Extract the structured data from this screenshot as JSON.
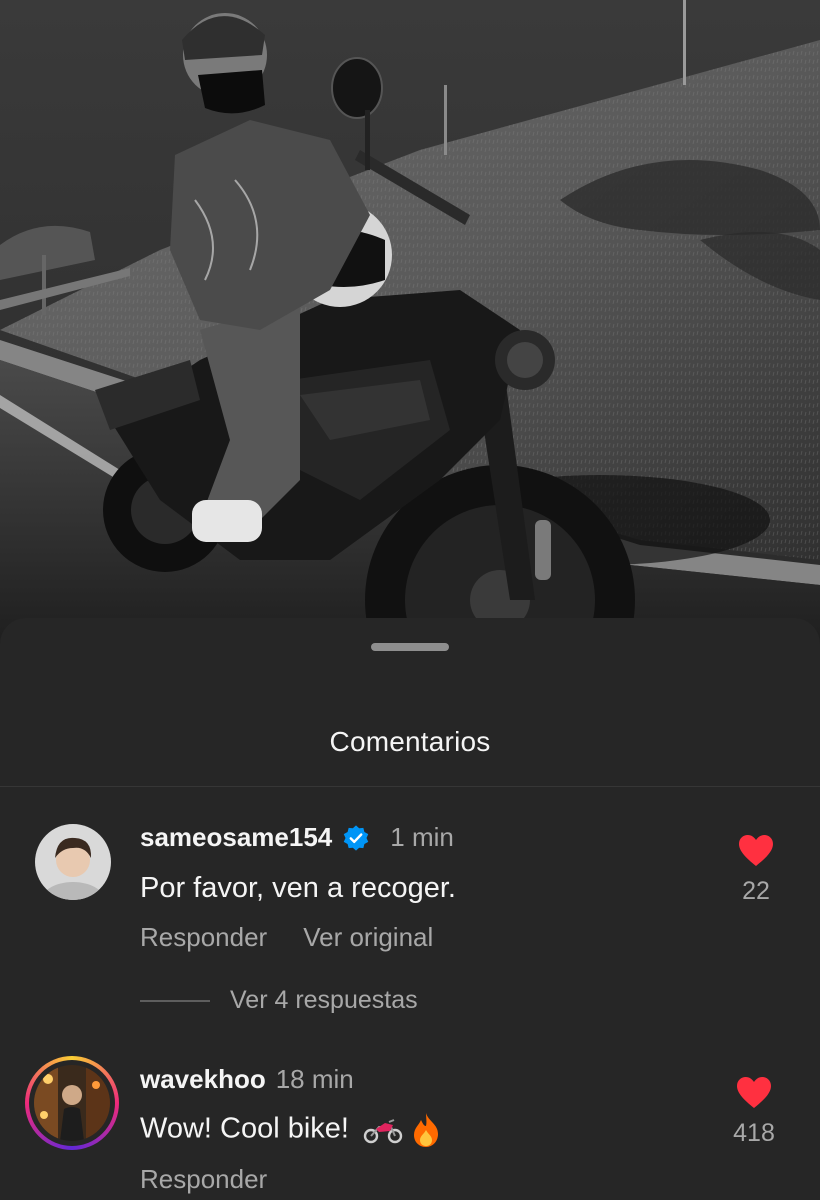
{
  "sheet": {
    "title": "Comentarios"
  },
  "comments": [
    {
      "username": "sameosame154",
      "verified": true,
      "time": "1 min",
      "text": "Por favor, ven a recoger.",
      "likes": "22",
      "actions": [
        "Responder",
        "Ver original"
      ],
      "replies_label": "Ver 4 respuestas",
      "liked": true
    },
    {
      "username": "wavekhoo",
      "verified": false,
      "time": "18 min",
      "text": "Wow! Cool bike!",
      "emojis": [
        "motorcycle-emoji",
        "fire-emoji"
      ],
      "likes": "418",
      "actions": [
        "Responder"
      ],
      "has_story_ring": true,
      "liked": true
    }
  ],
  "colors": {
    "sheet_background": "#262626",
    "like_red": "#ff3040",
    "verified_blue": "#0095f6",
    "secondary_text": "#a8a8a8"
  }
}
